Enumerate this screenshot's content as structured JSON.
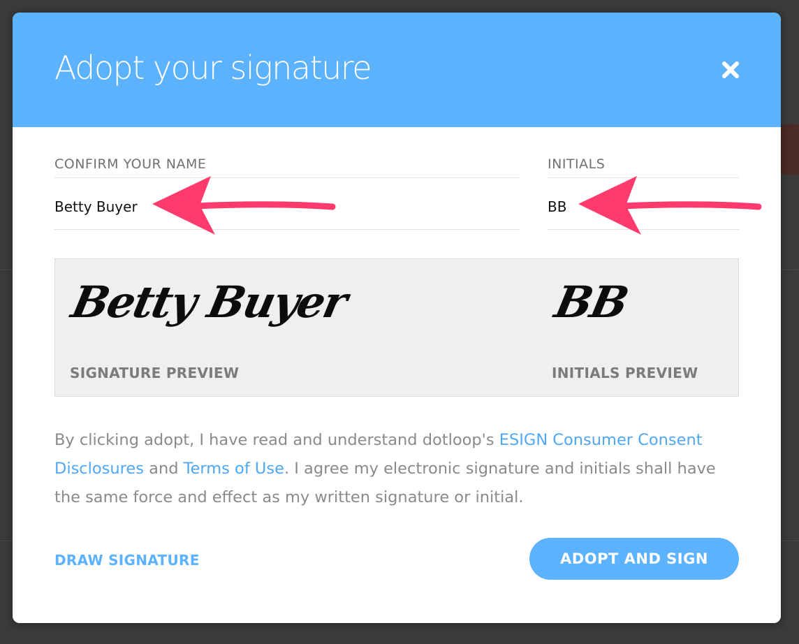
{
  "dialog": {
    "title": "Adopt your signature",
    "close_icon": "close-icon"
  },
  "fields": {
    "name_label": "CONFIRM YOUR NAME",
    "name_value": "Betty Buyer",
    "initials_label": "INITIALS",
    "initials_value": "BB"
  },
  "preview": {
    "signature_text": "Betty Buyer",
    "signature_label": "SIGNATURE PREVIEW",
    "initials_text": "BB",
    "initials_label": "INITIALS PREVIEW"
  },
  "legal": {
    "text_1": "By clicking adopt, I have read and understand dotloop's ",
    "link_esign": "ESIGN Consumer Consent Disclosures",
    "text_2": " and ",
    "link_terms": "Terms of Use",
    "text_3": ". I agree my electronic signature and initials shall have the same force and effect as my written signature or initial."
  },
  "actions": {
    "draw_signature": "DRAW SIGNATURE",
    "adopt_and_sign": "ADOPT AND SIGN"
  },
  "colors": {
    "header": "#5cb2fd",
    "link": "#4fa8f5",
    "annotation_arrow": "#ff3b6e"
  }
}
